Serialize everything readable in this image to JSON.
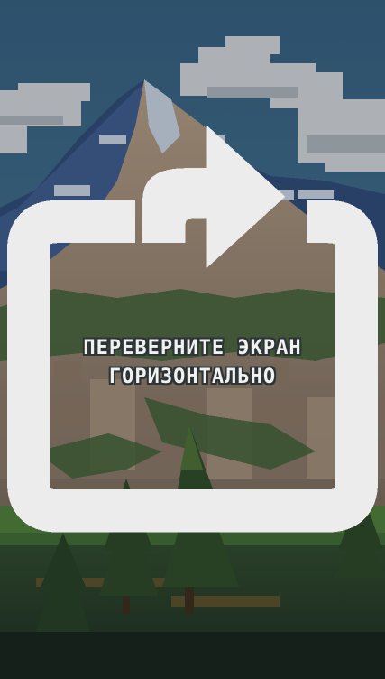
{
  "game": {
    "prompt_line_1": "ПЕРЕВЕРНИТЕ ЭКРАН",
    "prompt_line_2": "ГОРИЗОНТАЛЬНО",
    "icon": "rotate-device-icon"
  },
  "colors": {
    "sky": "#3f6a8c",
    "cloud": "#d8d8dc",
    "mountain_shadow": "#2f4a7a",
    "mountain_rock": "#9a8470",
    "snow": "#c9d4e3",
    "forest": "#3a5a2e",
    "text": "#f1f1f1"
  }
}
